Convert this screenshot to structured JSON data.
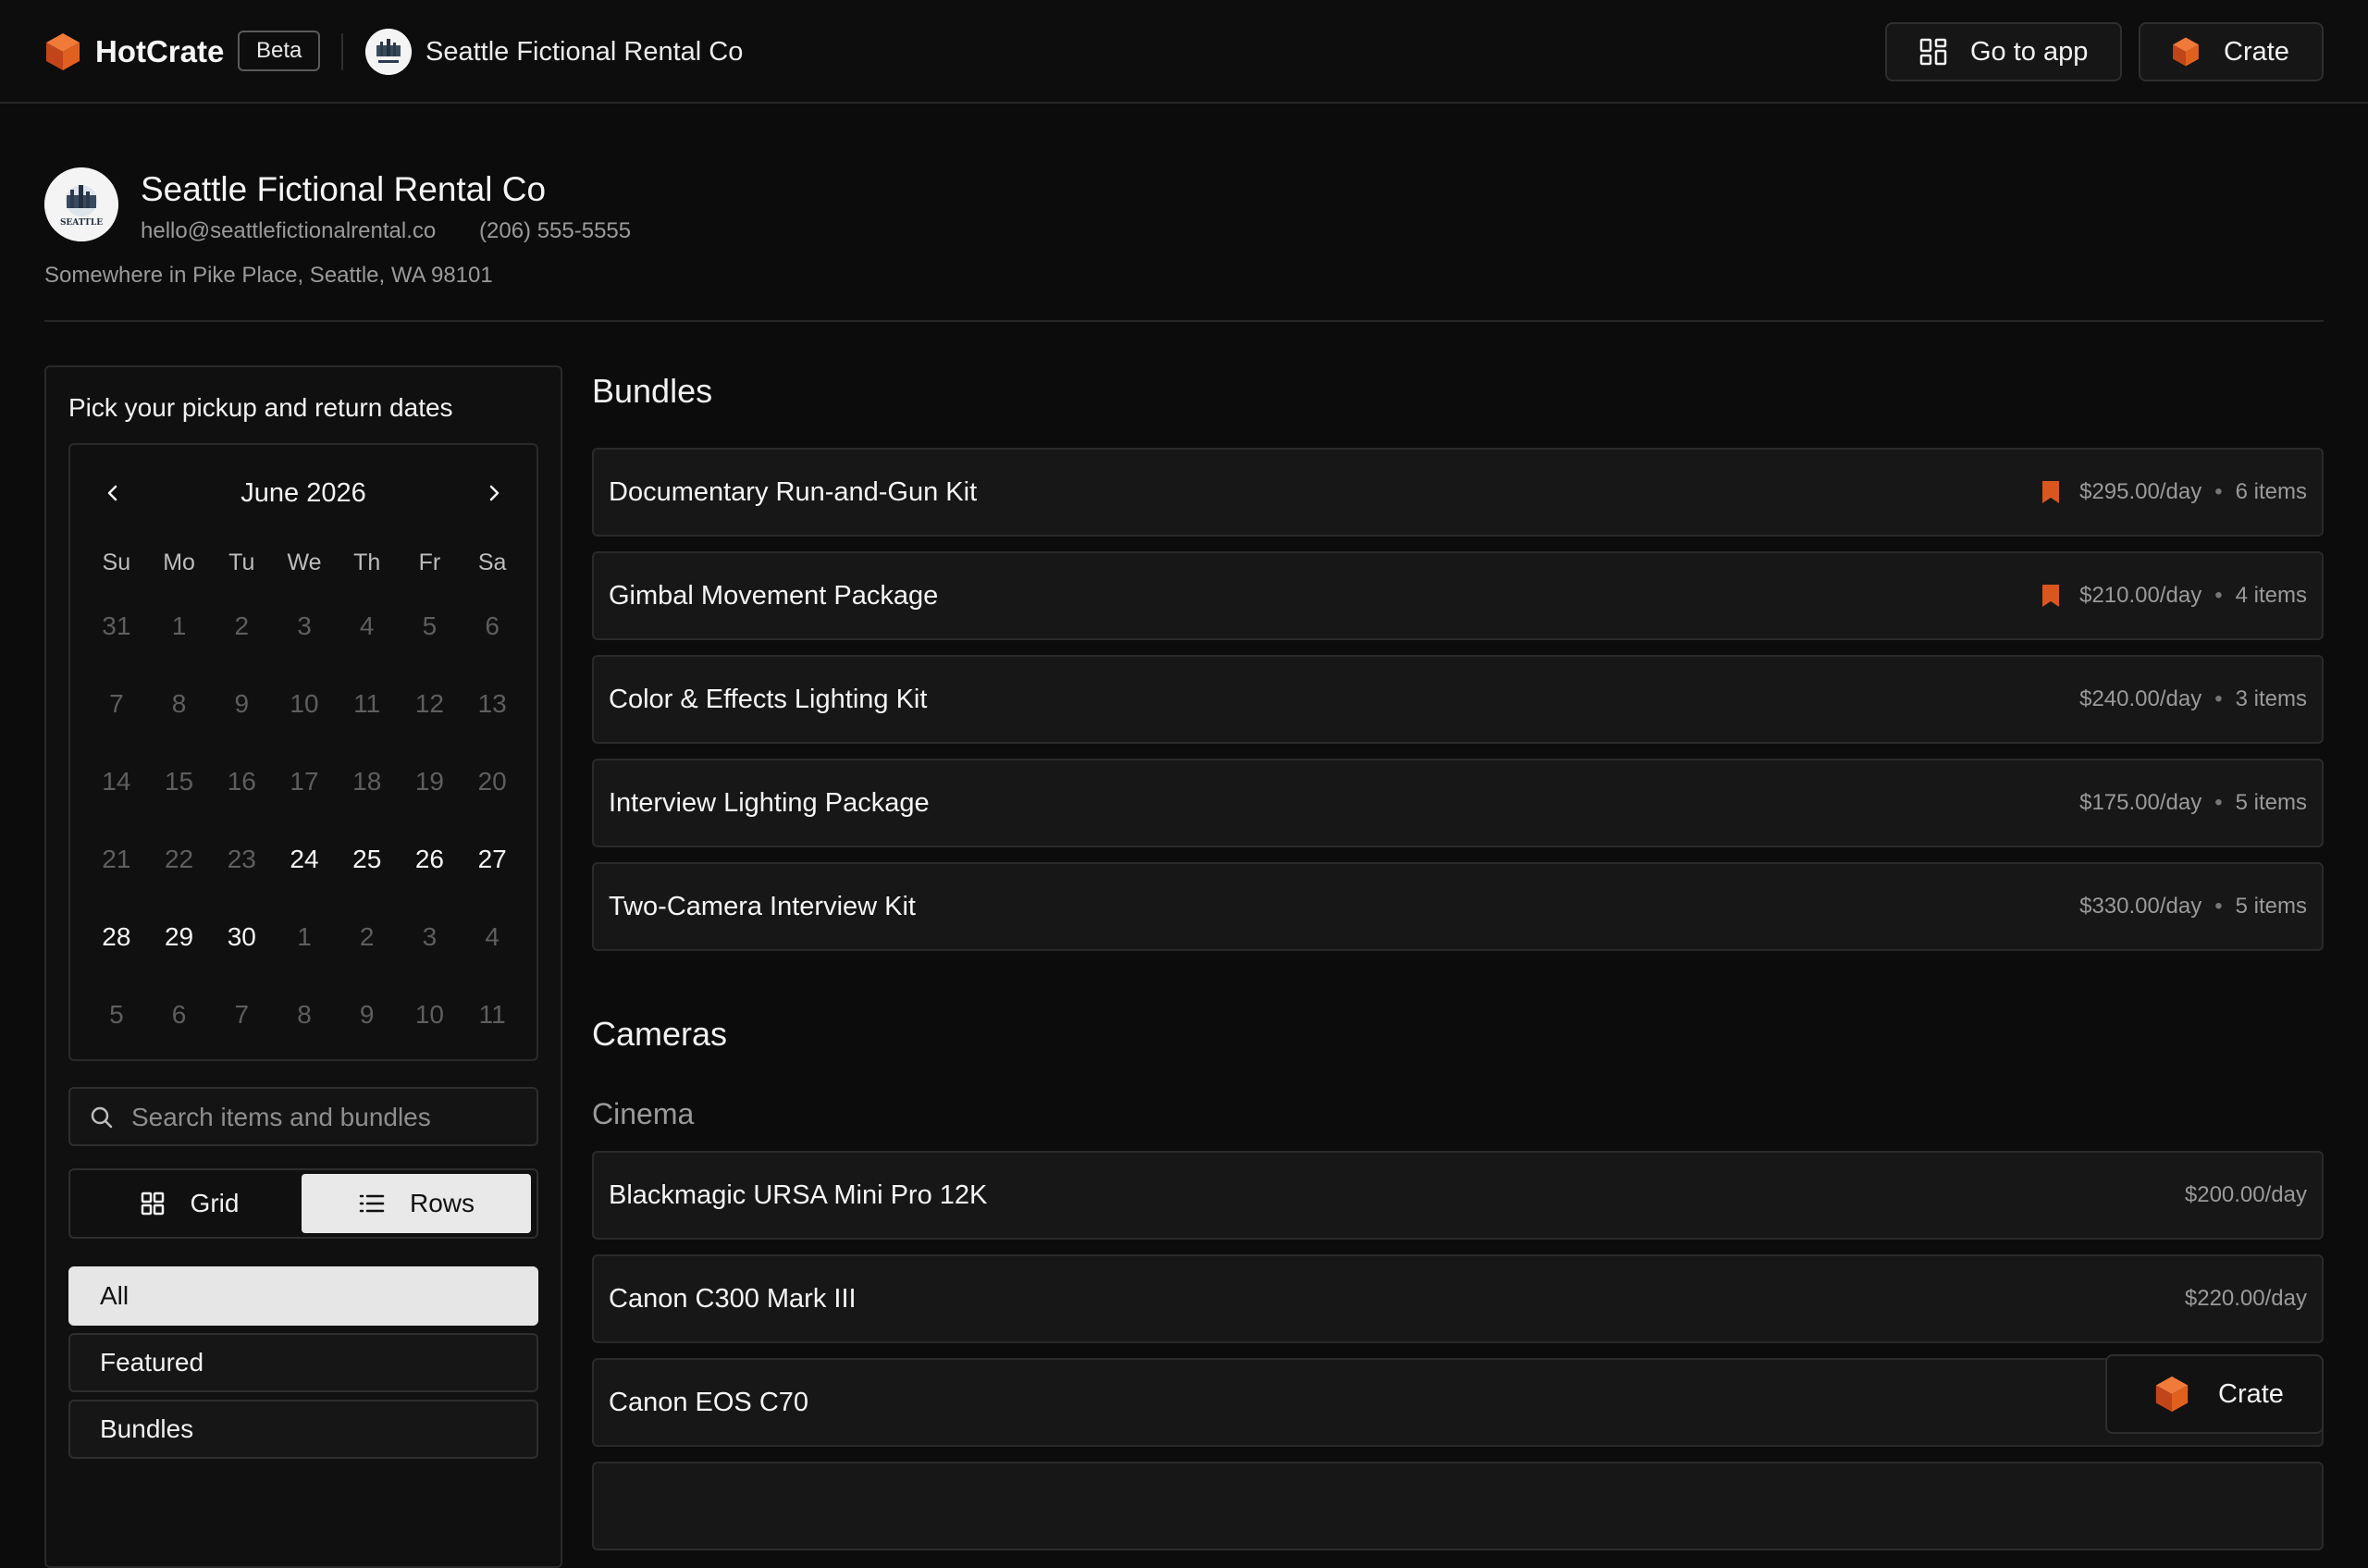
{
  "brand": {
    "name": "HotCrate",
    "badge": "Beta"
  },
  "header": {
    "company": "Seattle Fictional Rental Co",
    "go_to_app": "Go to app",
    "crate": "Crate"
  },
  "colors": {
    "accent": "#d9571e",
    "background": "#0c0c0c",
    "surface": "#171717"
  },
  "profile": {
    "name": "Seattle Fictional Rental Co",
    "email": "hello@seattlefictionalrental.co",
    "phone": "(206) 555-5555",
    "address": "Somewhere in Pike Place, Seattle, WA 98101",
    "logo_text": "SEATTLE"
  },
  "sidebar": {
    "title": "Pick your pickup and return dates",
    "calendar": {
      "month": "June 2026",
      "weekdays": [
        "Su",
        "Mo",
        "Tu",
        "We",
        "Th",
        "Fr",
        "Sa"
      ],
      "days": [
        {
          "label": "31",
          "active": false
        },
        {
          "label": "1",
          "active": false
        },
        {
          "label": "2",
          "active": false
        },
        {
          "label": "3",
          "active": false
        },
        {
          "label": "4",
          "active": false
        },
        {
          "label": "5",
          "active": false
        },
        {
          "label": "6",
          "active": false
        },
        {
          "label": "7",
          "active": false
        },
        {
          "label": "8",
          "active": false
        },
        {
          "label": "9",
          "active": false
        },
        {
          "label": "10",
          "active": false
        },
        {
          "label": "11",
          "active": false
        },
        {
          "label": "12",
          "active": false
        },
        {
          "label": "13",
          "active": false
        },
        {
          "label": "14",
          "active": false
        },
        {
          "label": "15",
          "active": false
        },
        {
          "label": "16",
          "active": false
        },
        {
          "label": "17",
          "active": false
        },
        {
          "label": "18",
          "active": false
        },
        {
          "label": "19",
          "active": false
        },
        {
          "label": "20",
          "active": false
        },
        {
          "label": "21",
          "active": false
        },
        {
          "label": "22",
          "active": false
        },
        {
          "label": "23",
          "active": false
        },
        {
          "label": "24",
          "active": true
        },
        {
          "label": "25",
          "active": true
        },
        {
          "label": "26",
          "active": true
        },
        {
          "label": "27",
          "active": true
        },
        {
          "label": "28",
          "active": true
        },
        {
          "label": "29",
          "active": true
        },
        {
          "label": "30",
          "active": true
        },
        {
          "label": "1",
          "active": false
        },
        {
          "label": "2",
          "active": false
        },
        {
          "label": "3",
          "active": false
        },
        {
          "label": "4",
          "active": false
        },
        {
          "label": "5",
          "active": false
        },
        {
          "label": "6",
          "active": false
        },
        {
          "label": "7",
          "active": false
        },
        {
          "label": "8",
          "active": false
        },
        {
          "label": "9",
          "active": false
        },
        {
          "label": "10",
          "active": false
        },
        {
          "label": "11",
          "active": false
        }
      ]
    },
    "search_placeholder": "Search items and bundles",
    "view_toggle": {
      "grid": "Grid",
      "rows": "Rows",
      "selected": "Rows"
    },
    "filters": [
      {
        "label": "All",
        "selected": true
      },
      {
        "label": "Featured",
        "selected": false
      },
      {
        "label": "Bundles",
        "selected": false
      }
    ]
  },
  "main": {
    "bundles_title": "Bundles",
    "bundles": [
      {
        "name": "Documentary Run-and-Gun Kit",
        "price": "$295.00/day",
        "items": "6 items",
        "featured": true
      },
      {
        "name": "Gimbal Movement Package",
        "price": "$210.00/day",
        "items": "4 items",
        "featured": true
      },
      {
        "name": "Color & Effects Lighting Kit",
        "price": "$240.00/day",
        "items": "3 items",
        "featured": false
      },
      {
        "name": "Interview Lighting Package",
        "price": "$175.00/day",
        "items": "5 items",
        "featured": false
      },
      {
        "name": "Two-Camera Interview Kit",
        "price": "$330.00/day",
        "items": "5 items",
        "featured": false
      }
    ],
    "cameras_title": "Cameras",
    "cinema_title": "Cinema",
    "cameras": [
      {
        "name": "Blackmagic URSA Mini Pro 12K",
        "price": "$200.00/day"
      },
      {
        "name": "Canon C300 Mark III",
        "price": "$220.00/day"
      },
      {
        "name": "Canon EOS C70",
        "price": ""
      }
    ]
  },
  "floating_crate": {
    "label": "Crate"
  }
}
